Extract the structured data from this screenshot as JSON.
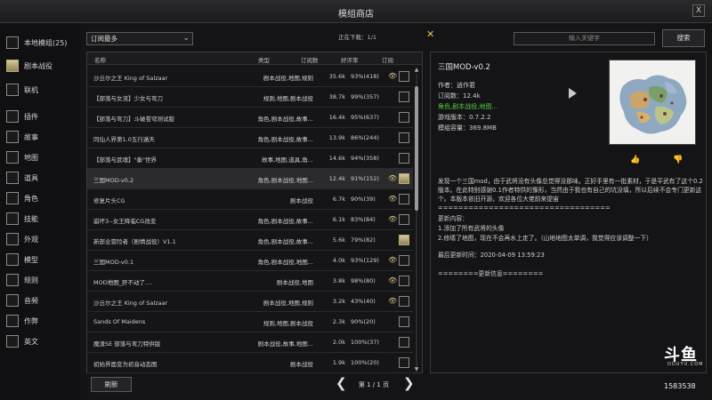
{
  "window": {
    "title": "模组商店",
    "close_label": "X"
  },
  "sidebar": {
    "items": [
      {
        "label": "本地模组(25)",
        "checked": false
      },
      {
        "label": "剧本战役",
        "checked": true
      },
      {
        "label": "联机",
        "checked": false
      },
      {
        "label": "插件",
        "checked": false
      },
      {
        "label": "故事",
        "checked": false
      },
      {
        "label": "地图",
        "checked": false
      },
      {
        "label": "道具",
        "checked": false
      },
      {
        "label": "角色",
        "checked": false
      },
      {
        "label": "技能",
        "checked": false
      },
      {
        "label": "外观",
        "checked": false
      },
      {
        "label": "模型",
        "checked": false
      },
      {
        "label": "规则",
        "checked": false
      },
      {
        "label": "音频",
        "checked": false
      },
      {
        "label": "作弊",
        "checked": false
      },
      {
        "label": "英文",
        "checked": false
      }
    ]
  },
  "toolbar": {
    "sort_value": "订阅最多",
    "sort_chevron": "⌄",
    "downloading_text": "正在下载：1/1",
    "cancel_download": "✕",
    "search_placeholder": "输入关键字",
    "search_label": "搜索"
  },
  "table": {
    "headers": {
      "name": "名称",
      "type": "类型",
      "subs": "订阅数",
      "rating": "好评率",
      "subscribe": "订阅"
    },
    "rows": [
      {
        "name": "沙丘尔之王 King of Salzaar",
        "type": "剧本战役,地图,规则",
        "subs": "35.6k",
        "rating": "93%(418)",
        "eye": true,
        "checked": false,
        "selected": false
      },
      {
        "name": "【部落与女流】少女与弯刀",
        "type": "规则,地图,剧本战役",
        "subs": "38.7k",
        "rating": "99%(357)",
        "eye": false,
        "checked": false,
        "selected": false
      },
      {
        "name": "【部落与弯刀】斗破苍穹测试版",
        "type": "角色,剧本战役,故事...",
        "subs": "16.4k",
        "rating": "95%(637)",
        "eye": false,
        "checked": false,
        "selected": false
      },
      {
        "name": "同仙人界第1.0五行遁天",
        "type": "角色,剧本战役,故事...",
        "subs": "13.9k",
        "rating": "86%(244)",
        "eye": false,
        "checked": false,
        "selected": false
      },
      {
        "name": "【部落与武魂】\"秦\"世界",
        "type": "故事,地图,道具,角...",
        "subs": "14.6k",
        "rating": "94%(358)",
        "eye": false,
        "checked": false,
        "selected": false
      },
      {
        "name": "三国MOD-v0.2",
        "type": "角色,剧本战役,地图...",
        "subs": "12.4k",
        "rating": "91%(152)",
        "eye": true,
        "checked": true,
        "selected": true
      },
      {
        "name": "修复片头CG",
        "type": "剧本战役",
        "subs": "6.7k",
        "rating": "90%(39)",
        "eye": true,
        "checked": false,
        "selected": false
      },
      {
        "name": "崩坏3--女王降临CG改变",
        "type": "角色,剧本战役,故事...",
        "subs": "6.1k",
        "rating": "83%(84)",
        "eye": true,
        "checked": false,
        "selected": false
      },
      {
        "name": "新部业冒险者（剧情战役）V1.1",
        "type": "角色,剧本战役,故事...",
        "subs": "5.6k",
        "rating": "79%(82)",
        "eye": false,
        "checked": true,
        "selected": false
      },
      {
        "name": "三国MOD-v0.1",
        "type": "角色,剧本战役,地图...",
        "subs": "4.0k",
        "rating": "93%(129)",
        "eye": true,
        "checked": false,
        "selected": false
      },
      {
        "name": "MOD地图_肝不动了....",
        "type": "剧本战役,地图",
        "subs": "3.8k",
        "rating": "98%(80)",
        "eye": true,
        "checked": false,
        "selected": false
      },
      {
        "name": "沙丘尔之王 King of Salzaar",
        "type": "剧本战役,地图,规则",
        "subs": "3.2k",
        "rating": "43%(40)",
        "eye": true,
        "checked": false,
        "selected": false
      },
      {
        "name": "Sands Of Maidens",
        "type": "规则,地图,剧本战役",
        "subs": "2.3k",
        "rating": "90%(20)",
        "eye": false,
        "checked": false,
        "selected": false
      },
      {
        "name": "魔渣SE 部落与弯刀特供版",
        "type": "剧本战役,故事,地图...",
        "subs": "2.0k",
        "rating": "100%(37)",
        "eye": false,
        "checked": false,
        "selected": false
      },
      {
        "name": "初始界面变为初音动态图",
        "type": "剧本战役",
        "subs": "1.9k",
        "rating": "100%(20)",
        "eye": false,
        "checked": false,
        "selected": false
      }
    ]
  },
  "pagination": {
    "refresh_label": "刷新",
    "page_text": "第 1 / 1 页",
    "prev": "❮",
    "next": "❯"
  },
  "detail": {
    "title": "三国MOD-v0.2",
    "author": "作者：逍作君",
    "subscriptions": "订阅数：12.4k",
    "tags": "角色,剧本战役,地图...",
    "game_version": "游戏版本：0.7.2.2",
    "size": "模组容量：369.8MB",
    "description": "发现一个三国mod，由于武将没有头像总觉得没那味。正好手里有一批素材，于是平武有了这个0.2版本。在此特别感谢0.1作者特供的豫形，当然由于我也有自己的坑没填，所以后续不会专门更新这个。本版本依旧开源，欢迎各位大佬前来提宙",
    "separator": "==================================",
    "changelog_title": "更新内容：",
    "changelog_1": "1.添加了所有武将的头像",
    "changelog_2": "2.修缮了地图，现在不会再水上走了。（山地地图太单调，我觉得应该调整一下）",
    "last_update": "最后更新时间：2020-04-09 13:59:23",
    "footer": "========更新信息========"
  },
  "watermark": {
    "logo": "斗鱼",
    "sub": "DOUYU.COM",
    "room": "1583538"
  }
}
